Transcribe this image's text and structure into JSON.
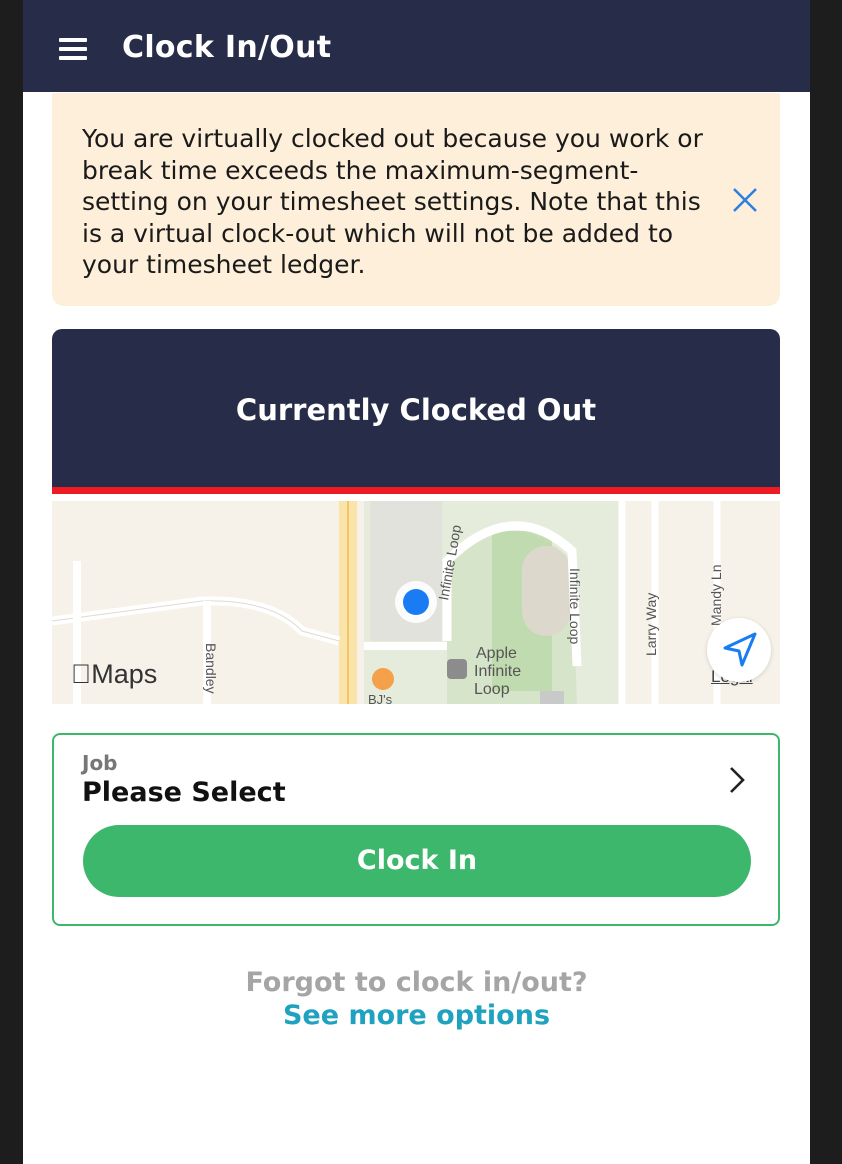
{
  "header": {
    "title": "Clock In/Out",
    "menu_icon": "hamburger-menu-icon"
  },
  "banner": {
    "message": "You are virtually clocked out because you work or break time exceeds the maximum-segment-setting on your timesheet settings. Note that this is a virtual clock-out which will not be added to your timesheet ledger.",
    "close_icon": "close-icon",
    "background_color": "#fdefd9"
  },
  "status": {
    "text": "Currently Clocked Out",
    "bar_color": "#ee1b24",
    "card_color": "#272d48"
  },
  "map": {
    "logo": "Maps",
    "legal": "Legal",
    "labels": {
      "infinite_loop_1": "Infinite Loop",
      "infinite_loop_2": "Infinite Loop",
      "larry_way": "Larry Way",
      "bandley": "Bandley",
      "andy_ln": "Mandy Ln",
      "apple": "Apple",
      "apple_infinite": "Infinite",
      "apple_loop": "Loop",
      "bjs": "BJ's"
    }
  },
  "job": {
    "label": "Job",
    "value": "Please Select",
    "clock_in_label": "Clock In",
    "accent_color": "#3db76b"
  },
  "footer": {
    "forgot_text": "Forgot to clock in/out?",
    "more_options_label": "See more options",
    "link_color": "#1ea2c0"
  }
}
